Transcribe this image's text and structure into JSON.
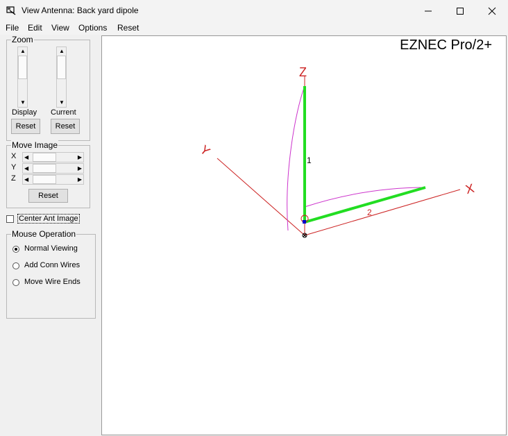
{
  "window": {
    "title": "View Antenna: Back yard dipole",
    "controls": {
      "minimize": "minimize-icon",
      "maximize": "maximize-icon",
      "close": "close-icon"
    }
  },
  "menu": [
    "File",
    "Edit",
    "View",
    "Options",
    "Reset"
  ],
  "zoom": {
    "title": "Zoom",
    "display_label": "Display",
    "current_label": "Current",
    "reset_label": "Reset"
  },
  "move_image": {
    "title": "Move Image",
    "axes": [
      "X",
      "Y",
      "Z"
    ],
    "reset_label": "Reset"
  },
  "center_ant_image": {
    "label": "Center Ant Image",
    "checked": false
  },
  "mouse_operation": {
    "title": "Mouse Operation",
    "options": [
      "Normal Viewing",
      "Add Conn Wires",
      "Move Wire Ends"
    ],
    "selected": "Normal Viewing"
  },
  "view": {
    "product_name": "EZNEC Pro/2+",
    "axis_labels": {
      "x": "X",
      "y": "Y",
      "z": "Z"
    },
    "wire_labels": [
      "1",
      "2"
    ],
    "colors": {
      "wire": "#22dd22",
      "axes": "#cc2222",
      "pattern": "#cc33cc",
      "source": "#0000cc"
    }
  }
}
